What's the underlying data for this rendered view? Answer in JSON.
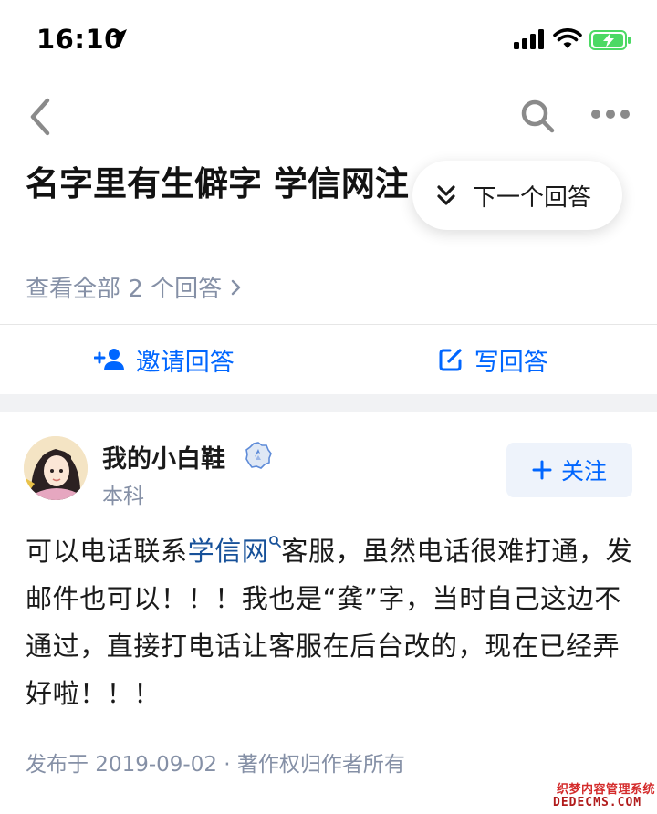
{
  "status_bar": {
    "time": "16:10",
    "icons": [
      "location-arrow-icon",
      "signal-bars-icon",
      "wifi-icon",
      "battery-charging-icon"
    ],
    "battery_color": "#4cd964"
  },
  "nav": {
    "icons": [
      "back-chevron-icon",
      "search-icon",
      "more-dots-icon"
    ]
  },
  "question": {
    "title": "名字里有生僻字 学信网注 办?",
    "all_answers_label": "查看全部 2 个回答"
  },
  "floating": {
    "next_answer_label": "下一个回答"
  },
  "actions": {
    "invite_label": "邀请回答",
    "write_label": "写回答",
    "accent_color": "#0066ff"
  },
  "author": {
    "name": "我的小白鞋",
    "education": "本科",
    "follow_label": "关注"
  },
  "answer": {
    "part1": "可以电话联系",
    "link_text": "学信网",
    "part2": "客服，虽然电话很难打通，发邮件也可以！！！我也是“龚”字，当时自己这边不通过，直接打电话让客服在后台改的，现在已经弄好啦！！！"
  },
  "footer": {
    "publish_info": "发布于 2019-09-02 · 著作权归作者所有"
  },
  "watermark": {
    "line1": "织梦内容管理系统",
    "line2": "DEDECMS.COM"
  }
}
